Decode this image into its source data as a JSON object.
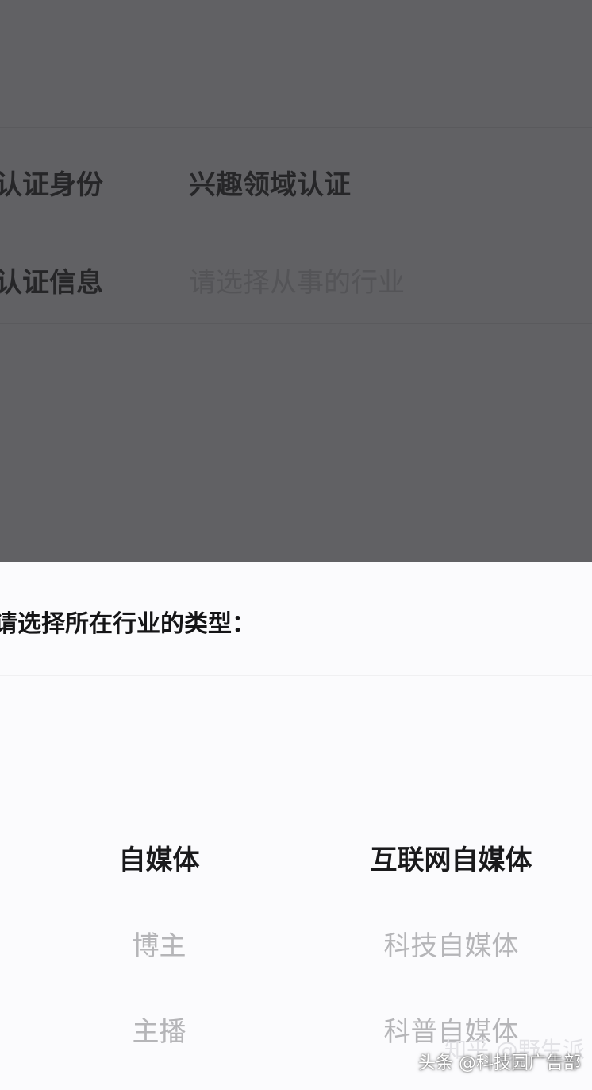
{
  "form": {
    "rows": [
      {
        "label": "认证身份",
        "value": "兴趣领域认证"
      },
      {
        "label": "认证信息",
        "placeholder": "请选择从事的行业"
      }
    ]
  },
  "sheet": {
    "title": "请选择所在行业的类型：",
    "left_column": {
      "items": [
        "自媒体",
        "博主",
        "主播"
      ],
      "selected": "自媒体"
    },
    "right_column": {
      "items": [
        "互联网自媒体",
        "科技自媒体",
        "科普自媒体"
      ],
      "selected": "互联网自媒体"
    }
  },
  "watermarks": {
    "faint": "知乎 @野生派",
    "main": "头条 @科技园广告部"
  }
}
